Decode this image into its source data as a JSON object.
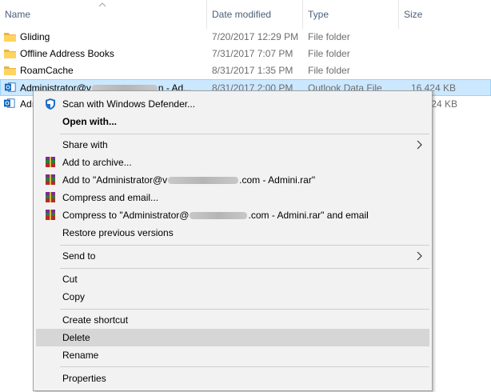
{
  "columns": {
    "name": "Name",
    "date": "Date modified",
    "type": "Type",
    "size": "Size"
  },
  "files": [
    {
      "name": "Gliding",
      "date": "7/20/2017 12:29 PM",
      "type": "File folder",
      "size": "",
      "icon": "folder-icon"
    },
    {
      "name": "Offline Address Books",
      "date": "7/31/2017 7:07 PM",
      "type": "File folder",
      "size": "",
      "icon": "folder-icon"
    },
    {
      "name": "RoamCache",
      "date": "8/31/2017 1:35 PM",
      "type": "File folder",
      "size": "",
      "icon": "folder-icon"
    },
    {
      "name_prefix": "Administrator@v",
      "name_suffix": "n - Ad...",
      "date": "8/31/2017 2:00 PM",
      "type": "Outlook Data File",
      "size": "16,424 KB",
      "icon": "outlook-data-file-icon",
      "selected": true
    },
    {
      "name_prefix": "Adı",
      "date": "",
      "type": "",
      "size": "24 KB",
      "icon": "outlook-data-file-icon"
    }
  ],
  "context_menu": {
    "items": [
      {
        "label": "Scan with Windows Defender...",
        "icon": "windows-defender-icon"
      },
      {
        "label": "Open with...",
        "bold": true
      },
      {
        "label": "Share with",
        "submenu": true
      },
      {
        "label": "Add to archive...",
        "icon": "winrar-icon"
      },
      {
        "label_prefix": "Add to \"Administrator@v",
        "label_suffix": ".com - Admini.rar\"",
        "icon": "winrar-icon"
      },
      {
        "label": "Compress and email...",
        "icon": "winrar-icon"
      },
      {
        "label_prefix": "Compress to \"Administrator@",
        "label_suffix": ".com - Admini.rar\" and email",
        "icon": "winrar-icon"
      },
      {
        "label": "Restore previous versions"
      },
      {
        "label": "Send to",
        "submenu": true
      },
      {
        "label": "Cut"
      },
      {
        "label": "Copy"
      },
      {
        "label": "Create shortcut"
      },
      {
        "label": "Delete",
        "hover": true
      },
      {
        "label": "Rename"
      },
      {
        "label": "Properties"
      }
    ]
  },
  "colors": {
    "selection_bg": "#cce8ff",
    "selection_border": "#99d1ff",
    "menu_bg": "#f2f2f2",
    "menu_hover": "#d6d6d6",
    "header_text": "#4c607a"
  }
}
